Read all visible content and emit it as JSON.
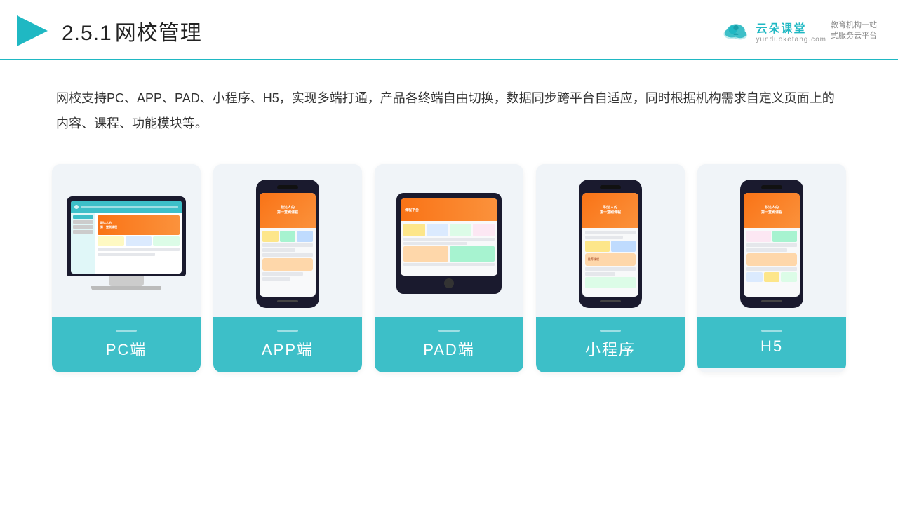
{
  "header": {
    "title": "2.5.1网校管理",
    "title_num": "2.5.1",
    "title_text": "网校管理",
    "logo_cn": "云朵课堂",
    "logo_en": "yunduoketang.com",
    "logo_tagline": "教育机构一站\n式服务云平台"
  },
  "description": {
    "text": "网校支持PC、APP、PAD、小程序、H5，实现多端打通，产品各终端自由切换，数据同步跨平台自适应，同时根据机构需求自定义页面上的内容、课程、功能模块等。"
  },
  "cards": [
    {
      "id": "pc",
      "label": "PC端"
    },
    {
      "id": "app",
      "label": "APP端"
    },
    {
      "id": "pad",
      "label": "PAD端"
    },
    {
      "id": "miniprogram",
      "label": "小程序"
    },
    {
      "id": "h5",
      "label": "H5"
    }
  ],
  "colors": {
    "accent": "#3dbfc8",
    "accent_dark": "#1fb8c3",
    "bg_card": "#eef2f6",
    "text_main": "#333333"
  }
}
